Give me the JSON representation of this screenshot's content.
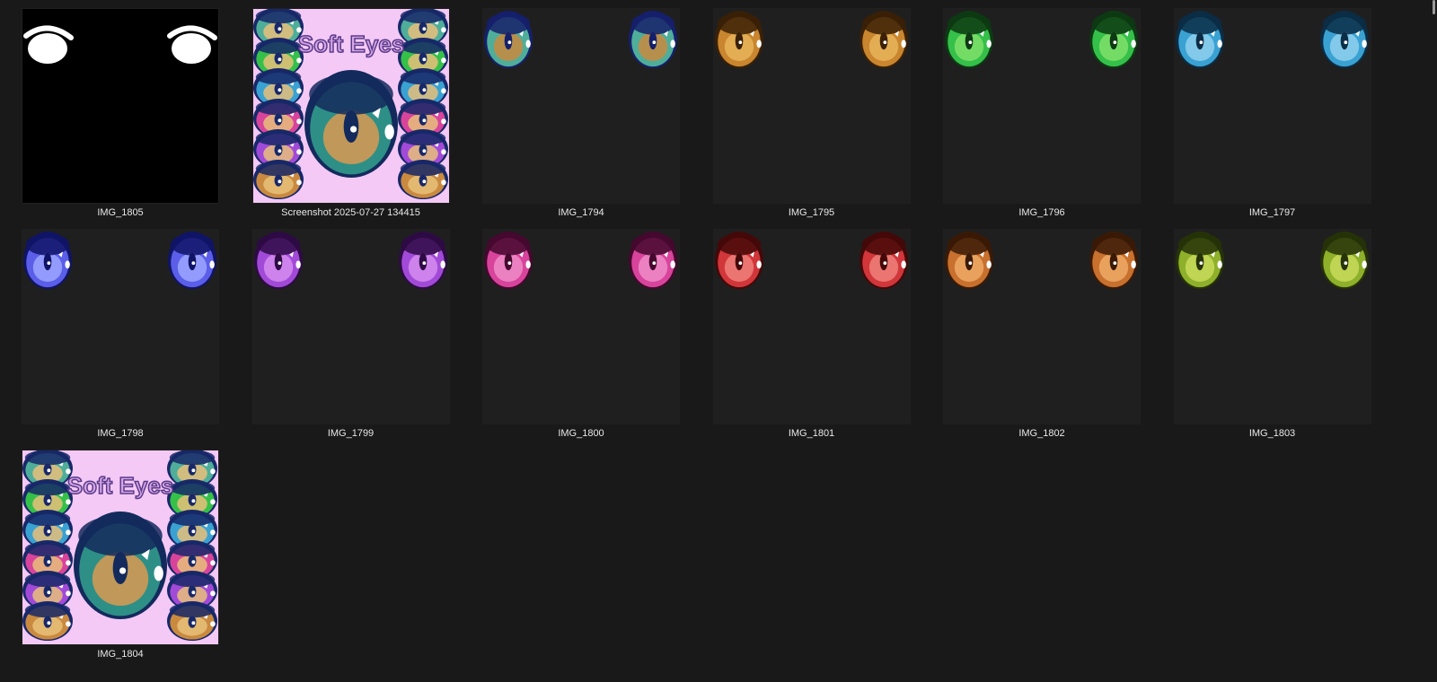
{
  "files": [
    {
      "name": "IMG_1805",
      "kind": "mask"
    },
    {
      "name": "Screenshot 2025-07-27 134415",
      "kind": "preview",
      "title": "Soft Eyes"
    },
    {
      "name": "IMG_1794",
      "kind": "eyes",
      "color": "#4fae9a",
      "inner": "#c98a3f",
      "rim": "#15206b"
    },
    {
      "name": "IMG_1795",
      "kind": "eyes",
      "color": "#c9862e",
      "inner": "#e8b45a",
      "rim": "#3a2006"
    },
    {
      "name": "IMG_1796",
      "kind": "eyes",
      "color": "#35c04a",
      "inner": "#7fe06a",
      "rim": "#0d3a12"
    },
    {
      "name": "IMG_1797",
      "kind": "eyes",
      "color": "#3aa2d2",
      "inner": "#8fd0ee",
      "rim": "#0b2d45"
    },
    {
      "name": "IMG_1798",
      "kind": "eyes",
      "color": "#5a5ee8",
      "inner": "#9ea6ff",
      "rim": "#101466"
    },
    {
      "name": "IMG_1799",
      "kind": "eyes",
      "color": "#a24ad8",
      "inner": "#d68cf0",
      "rim": "#2e0b45"
    },
    {
      "name": "IMG_1800",
      "kind": "eyes",
      "color": "#d8449c",
      "inner": "#f08cc8",
      "rim": "#45082e"
    },
    {
      "name": "IMG_1801",
      "kind": "eyes",
      "color": "#d0363a",
      "inner": "#f0807a",
      "rim": "#450808"
    },
    {
      "name": "IMG_1802",
      "kind": "eyes",
      "color": "#c8702e",
      "inner": "#eeaa66",
      "rim": "#3a1a06"
    },
    {
      "name": "IMG_1803",
      "kind": "eyes",
      "color": "#8eb02a",
      "inner": "#c8dc5a",
      "rim": "#263308"
    },
    {
      "name": "IMG_1804",
      "kind": "preview",
      "title": "Soft Eyes"
    }
  ],
  "preview_colors": [
    "#4fae9a",
    "#35c04a",
    "#3aa2d2",
    "#d8449c",
    "#a24ad8",
    "#c98a3f"
  ]
}
